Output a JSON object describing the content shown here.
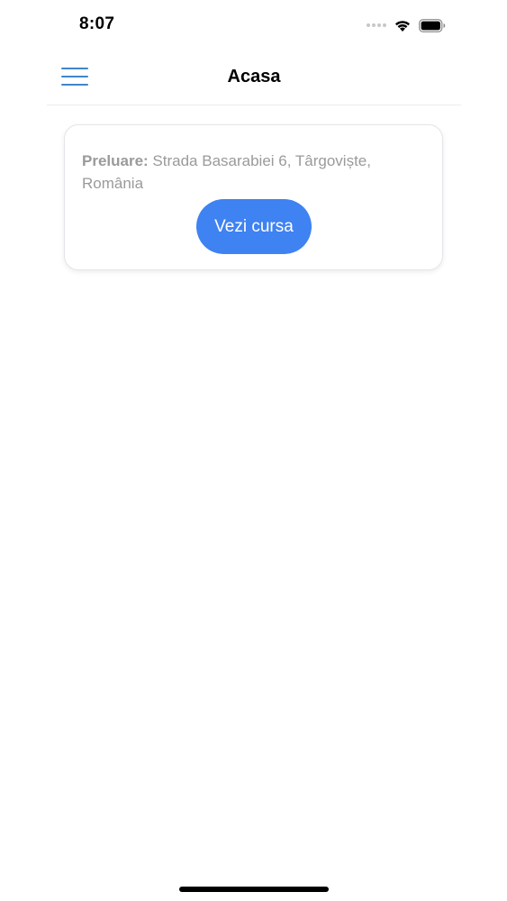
{
  "status_bar": {
    "time": "8:07",
    "icons": [
      "signal-dots-icon",
      "wifi-icon",
      "battery-icon"
    ]
  },
  "nav": {
    "title": "Acasa",
    "menu_icon": "hamburger-menu-icon"
  },
  "ride_card": {
    "pickup_label": "Preluare:",
    "pickup_address": " Strada Basarabiei 6, Târgoviște, România",
    "button_label": "Vezi cursa"
  },
  "colors": {
    "accent_blue": "#3f82f1",
    "menu_blue": "#3f86c9",
    "muted_text": "#9a9a9a"
  }
}
